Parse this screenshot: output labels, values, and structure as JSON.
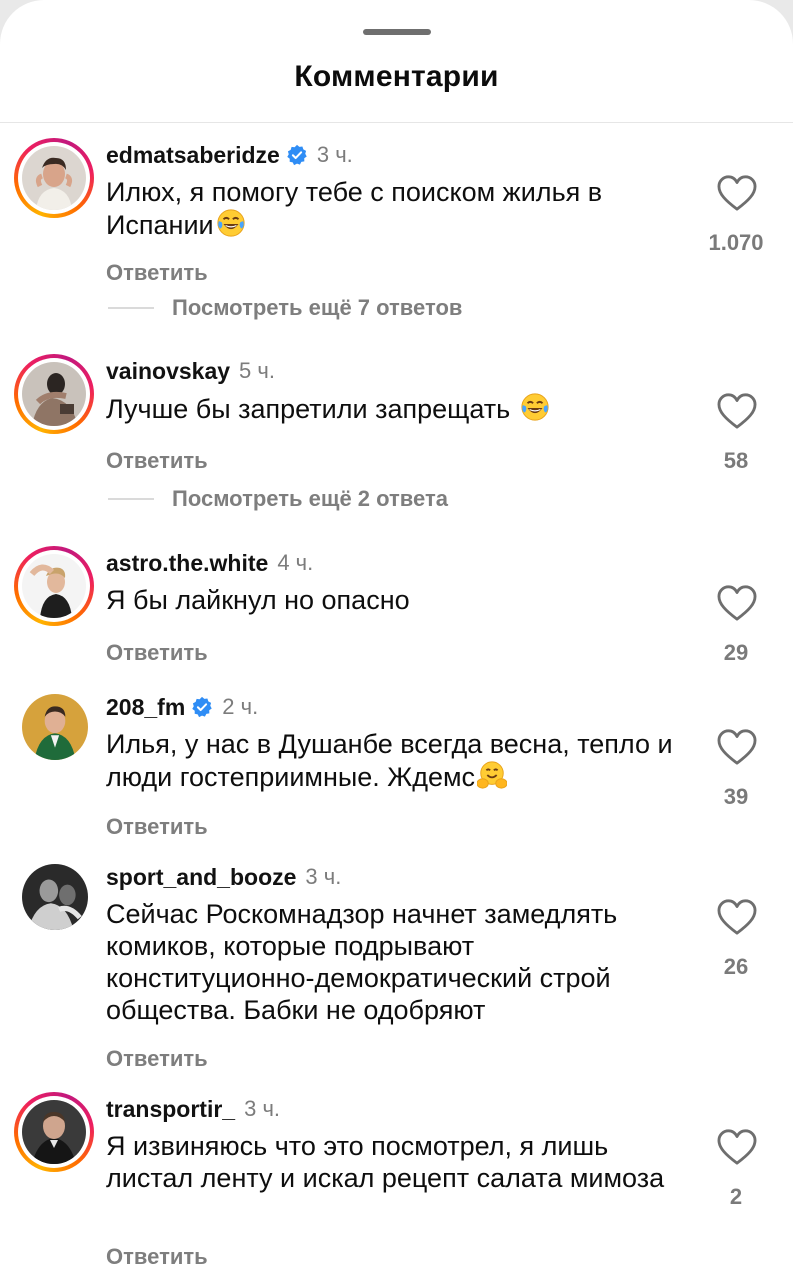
{
  "sheet": {
    "title": "Комментарии"
  },
  "comments": [
    {
      "username": "edmatsaberidze",
      "verified": true,
      "time": "3 ч.",
      "text": "Илюх, я помогу тебе с поиском жилья в Испании",
      "emoji": "face-with-tears-of-joy",
      "reply_label": "Ответить",
      "likes": "1.070",
      "more_replies": "Посмотреть ещё 7 ответов"
    },
    {
      "username": "vainovskay",
      "verified": false,
      "time": "5 ч.",
      "text": "Лучше бы запретили запрещать",
      "emoji": "face-with-tears-of-joy",
      "reply_label": "Ответить",
      "likes": "58",
      "more_replies": "Посмотреть ещё 2 ответа"
    },
    {
      "username": "astro.the.white",
      "verified": false,
      "time": "4 ч.",
      "text": "Я бы лайкнул но опасно",
      "reply_label": "Ответить",
      "likes": "29"
    },
    {
      "username": "208_fm",
      "verified": true,
      "time": "2 ч.",
      "text": "Илья, у нас в Душанбе всегда весна, тепло и люди гостеприимные. Ждемс",
      "emoji": "hugging-face",
      "reply_label": "Ответить",
      "likes": "39"
    },
    {
      "username": "sport_and_booze",
      "verified": false,
      "time": "3 ч.",
      "text": "Сейчас Роскомнадзор начнет замедлять комиков, которые подрывают конституционно-демократический строй общества. Бабки не одобряют",
      "reply_label": "Ответить",
      "likes": "26"
    },
    {
      "username": "transportir_",
      "verified": false,
      "time": "3 ч.",
      "text": "Я извиняюсь что это посмотрел, я лишь листал ленту и искал рецепт салата мимоза",
      "reply_label": "Ответить",
      "likes": "2"
    }
  ],
  "colors": {
    "verified_badge": "#2f8df5",
    "story_ring": "#ee1f5f",
    "secondary_text": "#7e7e7e"
  }
}
